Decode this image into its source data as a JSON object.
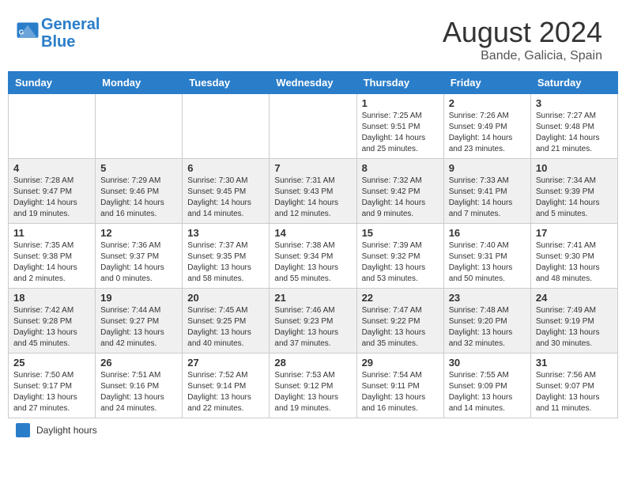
{
  "header": {
    "logo_line1": "General",
    "logo_line2": "Blue",
    "month_title": "August 2024",
    "location": "Bande, Galicia, Spain"
  },
  "calendar": {
    "days_of_week": [
      "Sunday",
      "Monday",
      "Tuesday",
      "Wednesday",
      "Thursday",
      "Friday",
      "Saturday"
    ],
    "weeks": [
      [
        {
          "day": "",
          "info": ""
        },
        {
          "day": "",
          "info": ""
        },
        {
          "day": "",
          "info": ""
        },
        {
          "day": "",
          "info": ""
        },
        {
          "day": "1",
          "info": "Sunrise: 7:25 AM\nSunset: 9:51 PM\nDaylight: 14 hours and 25 minutes."
        },
        {
          "day": "2",
          "info": "Sunrise: 7:26 AM\nSunset: 9:49 PM\nDaylight: 14 hours and 23 minutes."
        },
        {
          "day": "3",
          "info": "Sunrise: 7:27 AM\nSunset: 9:48 PM\nDaylight: 14 hours and 21 minutes."
        }
      ],
      [
        {
          "day": "4",
          "info": "Sunrise: 7:28 AM\nSunset: 9:47 PM\nDaylight: 14 hours and 19 minutes."
        },
        {
          "day": "5",
          "info": "Sunrise: 7:29 AM\nSunset: 9:46 PM\nDaylight: 14 hours and 16 minutes."
        },
        {
          "day": "6",
          "info": "Sunrise: 7:30 AM\nSunset: 9:45 PM\nDaylight: 14 hours and 14 minutes."
        },
        {
          "day": "7",
          "info": "Sunrise: 7:31 AM\nSunset: 9:43 PM\nDaylight: 14 hours and 12 minutes."
        },
        {
          "day": "8",
          "info": "Sunrise: 7:32 AM\nSunset: 9:42 PM\nDaylight: 14 hours and 9 minutes."
        },
        {
          "day": "9",
          "info": "Sunrise: 7:33 AM\nSunset: 9:41 PM\nDaylight: 14 hours and 7 minutes."
        },
        {
          "day": "10",
          "info": "Sunrise: 7:34 AM\nSunset: 9:39 PM\nDaylight: 14 hours and 5 minutes."
        }
      ],
      [
        {
          "day": "11",
          "info": "Sunrise: 7:35 AM\nSunset: 9:38 PM\nDaylight: 14 hours and 2 minutes."
        },
        {
          "day": "12",
          "info": "Sunrise: 7:36 AM\nSunset: 9:37 PM\nDaylight: 14 hours and 0 minutes."
        },
        {
          "day": "13",
          "info": "Sunrise: 7:37 AM\nSunset: 9:35 PM\nDaylight: 13 hours and 58 minutes."
        },
        {
          "day": "14",
          "info": "Sunrise: 7:38 AM\nSunset: 9:34 PM\nDaylight: 13 hours and 55 minutes."
        },
        {
          "day": "15",
          "info": "Sunrise: 7:39 AM\nSunset: 9:32 PM\nDaylight: 13 hours and 53 minutes."
        },
        {
          "day": "16",
          "info": "Sunrise: 7:40 AM\nSunset: 9:31 PM\nDaylight: 13 hours and 50 minutes."
        },
        {
          "day": "17",
          "info": "Sunrise: 7:41 AM\nSunset: 9:30 PM\nDaylight: 13 hours and 48 minutes."
        }
      ],
      [
        {
          "day": "18",
          "info": "Sunrise: 7:42 AM\nSunset: 9:28 PM\nDaylight: 13 hours and 45 minutes."
        },
        {
          "day": "19",
          "info": "Sunrise: 7:44 AM\nSunset: 9:27 PM\nDaylight: 13 hours and 42 minutes."
        },
        {
          "day": "20",
          "info": "Sunrise: 7:45 AM\nSunset: 9:25 PM\nDaylight: 13 hours and 40 minutes."
        },
        {
          "day": "21",
          "info": "Sunrise: 7:46 AM\nSunset: 9:23 PM\nDaylight: 13 hours and 37 minutes."
        },
        {
          "day": "22",
          "info": "Sunrise: 7:47 AM\nSunset: 9:22 PM\nDaylight: 13 hours and 35 minutes."
        },
        {
          "day": "23",
          "info": "Sunrise: 7:48 AM\nSunset: 9:20 PM\nDaylight: 13 hours and 32 minutes."
        },
        {
          "day": "24",
          "info": "Sunrise: 7:49 AM\nSunset: 9:19 PM\nDaylight: 13 hours and 30 minutes."
        }
      ],
      [
        {
          "day": "25",
          "info": "Sunrise: 7:50 AM\nSunset: 9:17 PM\nDaylight: 13 hours and 27 minutes."
        },
        {
          "day": "26",
          "info": "Sunrise: 7:51 AM\nSunset: 9:16 PM\nDaylight: 13 hours and 24 minutes."
        },
        {
          "day": "27",
          "info": "Sunrise: 7:52 AM\nSunset: 9:14 PM\nDaylight: 13 hours and 22 minutes."
        },
        {
          "day": "28",
          "info": "Sunrise: 7:53 AM\nSunset: 9:12 PM\nDaylight: 13 hours and 19 minutes."
        },
        {
          "day": "29",
          "info": "Sunrise: 7:54 AM\nSunset: 9:11 PM\nDaylight: 13 hours and 16 minutes."
        },
        {
          "day": "30",
          "info": "Sunrise: 7:55 AM\nSunset: 9:09 PM\nDaylight: 13 hours and 14 minutes."
        },
        {
          "day": "31",
          "info": "Sunrise: 7:56 AM\nSunset: 9:07 PM\nDaylight: 13 hours and 11 minutes."
        }
      ]
    ]
  },
  "footer": {
    "legend_label": "Daylight hours"
  }
}
